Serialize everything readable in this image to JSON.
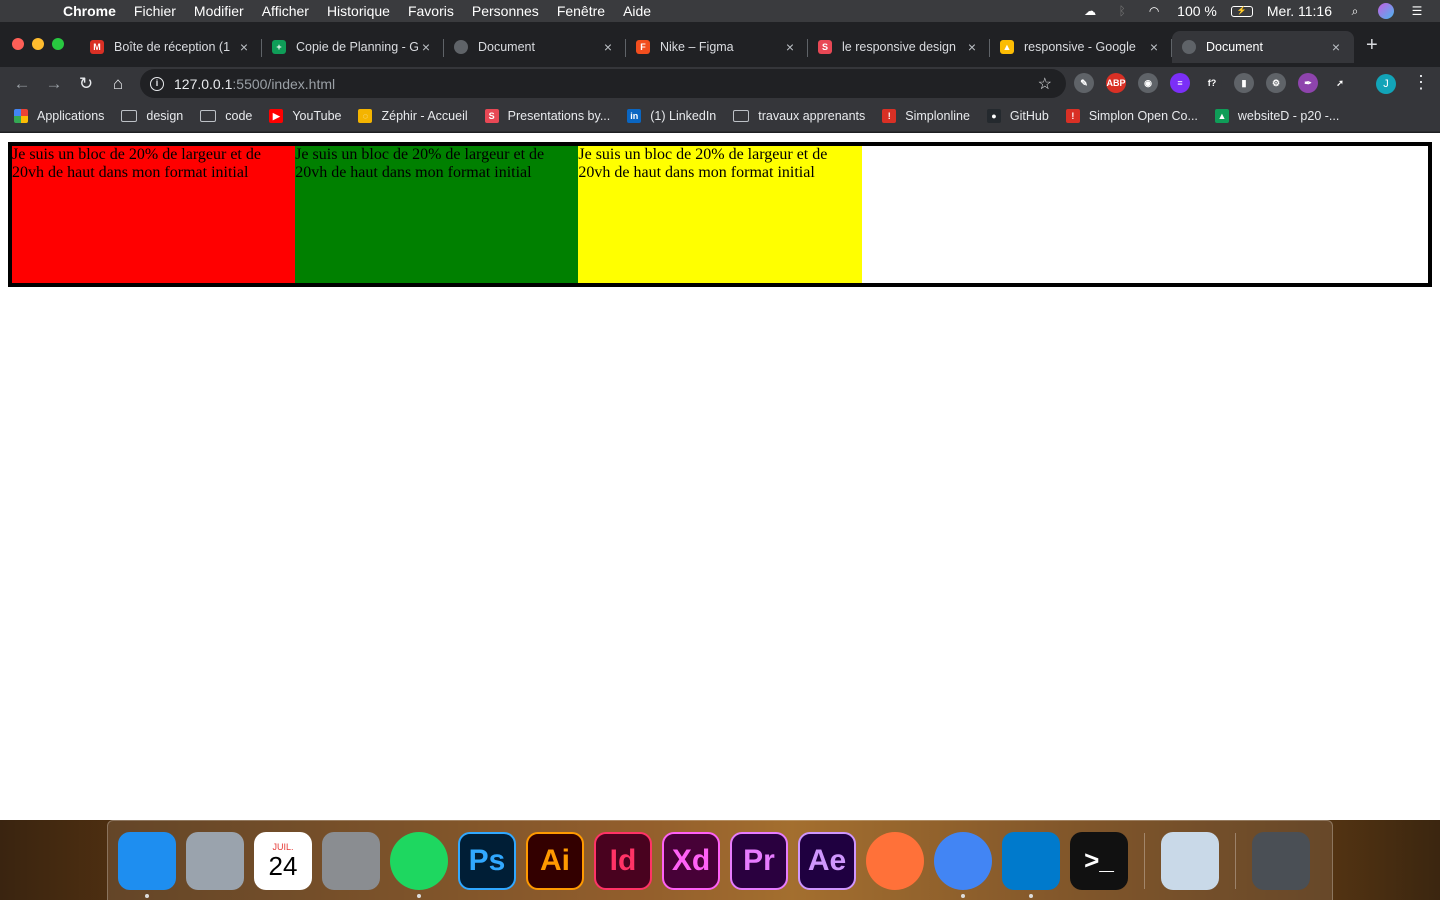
{
  "menubar": {
    "app": "Chrome",
    "items": [
      "Fichier",
      "Modifier",
      "Afficher",
      "Historique",
      "Favoris",
      "Personnes",
      "Fenêtre",
      "Aide"
    ],
    "battery": "100 %",
    "clock": "Mer. 11:16"
  },
  "tabs": [
    {
      "title": "Boîte de réception (1",
      "icon": "gmail-icon",
      "color": "#d93025",
      "glyph": "M",
      "active": false
    },
    {
      "title": "Copie de Planning - G",
      "icon": "sheets-icon",
      "color": "#0f9d58",
      "glyph": "+",
      "active": false
    },
    {
      "title": "Document",
      "icon": "globe-icon",
      "color": "#5f6368",
      "glyph": "",
      "active": false
    },
    {
      "title": "Nike – Figma",
      "icon": "figma-icon",
      "color": "#f24e1e",
      "glyph": "F",
      "active": false
    },
    {
      "title": "le responsive design",
      "icon": "simplonline-s-icon",
      "color": "#e84855",
      "glyph": "S",
      "active": false
    },
    {
      "title": "responsive - Google",
      "icon": "drive-icon",
      "color": "#fbbc04",
      "glyph": "▲",
      "active": false
    },
    {
      "title": "Document",
      "icon": "globe-icon",
      "color": "#5f6368",
      "glyph": "",
      "active": true
    }
  ],
  "omnibox": {
    "host": "127.0.0.1",
    "path": ":5500/index.html"
  },
  "extensions": [
    {
      "icon": "pen-extension-icon",
      "color": "#5f6368",
      "glyph": "✎"
    },
    {
      "icon": "adblock-icon",
      "color": "#d93025",
      "glyph": "ABP"
    },
    {
      "icon": "record-extension-icon",
      "color": "#5f6368",
      "glyph": "◉"
    },
    {
      "icon": "stack-extension-icon",
      "color": "#7b2ff7",
      "glyph": "≡"
    },
    {
      "icon": "font-extension-icon",
      "color": "#35363a",
      "glyph": "f?"
    },
    {
      "icon": "ruler-extension-icon",
      "color": "#5f6368",
      "glyph": "▮"
    },
    {
      "icon": "gear-extension-icon",
      "color": "#5f6368",
      "glyph": "⚙"
    },
    {
      "icon": "feather-extension-icon",
      "color": "#8e44ad",
      "glyph": "✒"
    },
    {
      "icon": "cursor-extension-icon",
      "color": "#35363a",
      "glyph": "➚"
    }
  ],
  "profile": {
    "initial": "J"
  },
  "bookmarks": [
    {
      "label": "Applications",
      "icon": "apps-grid-icon",
      "kind": "apps",
      "color": "#4285f4"
    },
    {
      "label": "design",
      "icon": "folder-icon",
      "kind": "folder"
    },
    {
      "label": "code",
      "icon": "folder-icon",
      "kind": "folder"
    },
    {
      "label": "YouTube",
      "icon": "youtube-icon",
      "kind": "site",
      "color": "#ff0000",
      "glyph": "▶"
    },
    {
      "label": "Zéphir - Accueil",
      "icon": "zephir-icon",
      "kind": "site",
      "color": "#f4b400",
      "glyph": "◌"
    },
    {
      "label": "Presentations by...",
      "icon": "slides-s-icon",
      "kind": "site",
      "color": "#e84855",
      "glyph": "S"
    },
    {
      "label": "(1) LinkedIn",
      "icon": "linkedin-icon",
      "kind": "site",
      "color": "#0a66c2",
      "glyph": "in"
    },
    {
      "label": "travaux apprenants",
      "icon": "folder-icon",
      "kind": "folder"
    },
    {
      "label": "Simplonline",
      "icon": "simplonline-icon",
      "kind": "site",
      "color": "#d93025",
      "glyph": "!"
    },
    {
      "label": "GitHub",
      "icon": "github-icon",
      "kind": "site",
      "color": "#24292e",
      "glyph": "●"
    },
    {
      "label": "Simplon Open Co...",
      "icon": "simplon-icon",
      "kind": "site",
      "color": "#d93025",
      "glyph": "!"
    },
    {
      "label": "websiteD - p20 -...",
      "icon": "drive-icon",
      "kind": "site",
      "color": "#0f9d58",
      "glyph": "▲"
    }
  ],
  "page": {
    "blocs": [
      {
        "text": "Je suis un bloc de 20% de largeur et de 20vh de haut dans mon format initial",
        "color": "#ff0000"
      },
      {
        "text": "Je suis un bloc de 20% de largeur et de 20vh de haut dans mon format initial",
        "color": "#008000"
      },
      {
        "text": "Je suis un bloc de 20% de largeur et de 20vh de haut dans mon format initial",
        "color": "#ffff00"
      }
    ]
  },
  "dock": {
    "calendar": {
      "month": "JUIL.",
      "day": "24"
    },
    "apps": [
      {
        "icon": "finder-icon",
        "label": "",
        "bg": "#1e8ef0",
        "fg": "#fff",
        "running": true
      },
      {
        "icon": "launchpad-rocket-icon",
        "label": "",
        "bg": "#9aa3ad",
        "fg": "#fff",
        "running": false
      },
      {
        "icon": "calendar-icon",
        "label": "",
        "bg": "#ffffff",
        "fg": "#000",
        "running": false
      },
      {
        "icon": "system-preferences-gear-icon",
        "label": "",
        "bg": "#8a8d91",
        "fg": "#333",
        "running": false
      },
      {
        "icon": "spotify-icon",
        "label": "",
        "bg": "#1ed760",
        "fg": "#000",
        "running": true
      },
      {
        "icon": "photoshop-icon",
        "label": "Ps",
        "bg": "#001e36",
        "fg": "#31a8ff",
        "running": false
      },
      {
        "icon": "illustrator-icon",
        "label": "Ai",
        "bg": "#330000",
        "fg": "#ff9a00",
        "running": false
      },
      {
        "icon": "indesign-icon",
        "label": "Id",
        "bg": "#49021f",
        "fg": "#ff3366",
        "running": false
      },
      {
        "icon": "xd-icon",
        "label": "Xd",
        "bg": "#470137",
        "fg": "#ff61f6",
        "running": false
      },
      {
        "icon": "premiere-icon",
        "label": "Pr",
        "bg": "#2a003f",
        "fg": "#e77cff",
        "running": false
      },
      {
        "icon": "after-effects-icon",
        "label": "Ae",
        "bg": "#1f0040",
        "fg": "#cf96fd",
        "running": false
      },
      {
        "icon": "firefox-icon",
        "label": "",
        "bg": "#ff7139",
        "fg": "#fff",
        "running": false
      },
      {
        "icon": "chrome-icon",
        "label": "",
        "bg": "#4285f4",
        "fg": "#fff",
        "running": true
      },
      {
        "icon": "vscode-icon",
        "label": "",
        "bg": "#007acc",
        "fg": "#fff",
        "running": true
      },
      {
        "icon": "terminal-icon",
        "label": ">_",
        "bg": "#111111",
        "fg": "#fff",
        "running": false
      },
      {
        "icon": "preview-photos-icon",
        "label": "",
        "bg": "#c9d9e8",
        "fg": "#333",
        "running": false
      },
      {
        "icon": "trash-icon",
        "label": "",
        "bg": "#4a4f55",
        "fg": "#ccc",
        "running": false
      }
    ]
  }
}
